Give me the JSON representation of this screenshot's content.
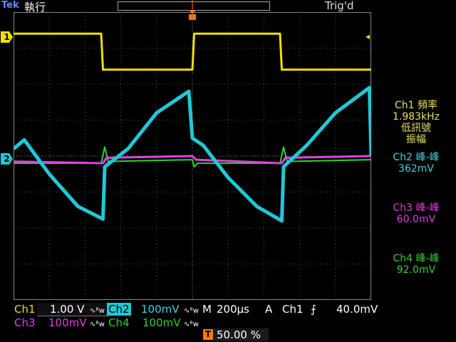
{
  "header": {
    "brand": "Tek",
    "run_state": "執行",
    "trig_status": "Trig'd"
  },
  "colors": {
    "ch1": "#f0e000",
    "ch2": "#20c8d8",
    "ch3": "#e040e0",
    "ch4": "#30d030",
    "grid": "#555555",
    "trigger": "#ff7a00"
  },
  "markers": {
    "ch1": "1",
    "ch2": "2",
    "trigger": "T"
  },
  "measurements": [
    {
      "channel": "Ch1",
      "lines": [
        "Ch1 頻率",
        "1.983kHz",
        "低訊號",
        "振幅"
      ]
    },
    {
      "channel": "Ch2",
      "lines": [
        "Ch2 峰-峰",
        "362mV"
      ]
    },
    {
      "channel": "Ch3",
      "lines": [
        "Ch3 峰-峰",
        "60.0mV"
      ]
    },
    {
      "channel": "Ch4",
      "lines": [
        "Ch4 峰-峰",
        "92.0mV"
      ]
    }
  ],
  "status": {
    "ch1_label": "Ch1",
    "ch1_scale": "1.00 V",
    "ch2_label": "Ch2",
    "ch2_scale": "100mV",
    "ch3_label": "Ch3",
    "ch3_scale": "100mV",
    "ch4_label": "Ch4",
    "ch4_scale": "100mV",
    "bw_icon": "∿ᴮw",
    "timebase_label": "M",
    "timebase": "200μs",
    "acq_mode": "A",
    "trig_source": "Ch1",
    "trig_slope": "⨍",
    "trig_level": "40.0mV",
    "trig_position": "50.00 %"
  },
  "chart_data": {
    "type": "line",
    "x_unit": "divisions",
    "time_per_div": "200μs",
    "xlim": [
      0,
      10
    ],
    "ylim": [
      -4,
      4
    ],
    "grid": true,
    "series": [
      {
        "name": "Ch1",
        "x": [
          0,
          0.05,
          2.45,
          2.5,
          5.0,
          5.05,
          7.45,
          7.5,
          10.0
        ],
        "values": [
          3.4,
          3.4,
          3.4,
          2.4,
          2.4,
          3.4,
          3.4,
          2.4,
          2.4
        ]
      },
      {
        "name": "Ch2",
        "x": [
          0,
          0.3,
          1.0,
          1.8,
          2.5,
          2.55,
          3.2,
          4.0,
          4.9,
          5.0,
          5.3,
          6.0,
          6.8,
          7.5,
          7.55,
          8.2,
          9.0,
          9.95,
          10.0
        ],
        "values": [
          0.2,
          0.45,
          -0.5,
          -1.4,
          -1.75,
          -0.3,
          0.2,
          1.2,
          1.8,
          0.5,
          0.3,
          -0.6,
          -1.4,
          -1.8,
          -0.3,
          0.3,
          1.2,
          1.9,
          0.0
        ]
      },
      {
        "name": "Ch3",
        "x": [
          0,
          2.5,
          2.6,
          5.0,
          5.1,
          7.5,
          7.6,
          10.0
        ],
        "values": [
          -0.15,
          -0.2,
          -0.05,
          0.0,
          -0.1,
          -0.2,
          -0.05,
          0.0
        ]
      },
      {
        "name": "Ch4",
        "x": [
          0,
          2.45,
          2.55,
          2.65,
          5.0,
          5.05,
          5.15,
          7.45,
          7.55,
          7.65,
          10.0
        ],
        "values": [
          -0.2,
          -0.2,
          0.25,
          -0.15,
          -0.1,
          -0.3,
          -0.2,
          -0.2,
          0.25,
          -0.15,
          -0.1
        ]
      }
    ]
  }
}
